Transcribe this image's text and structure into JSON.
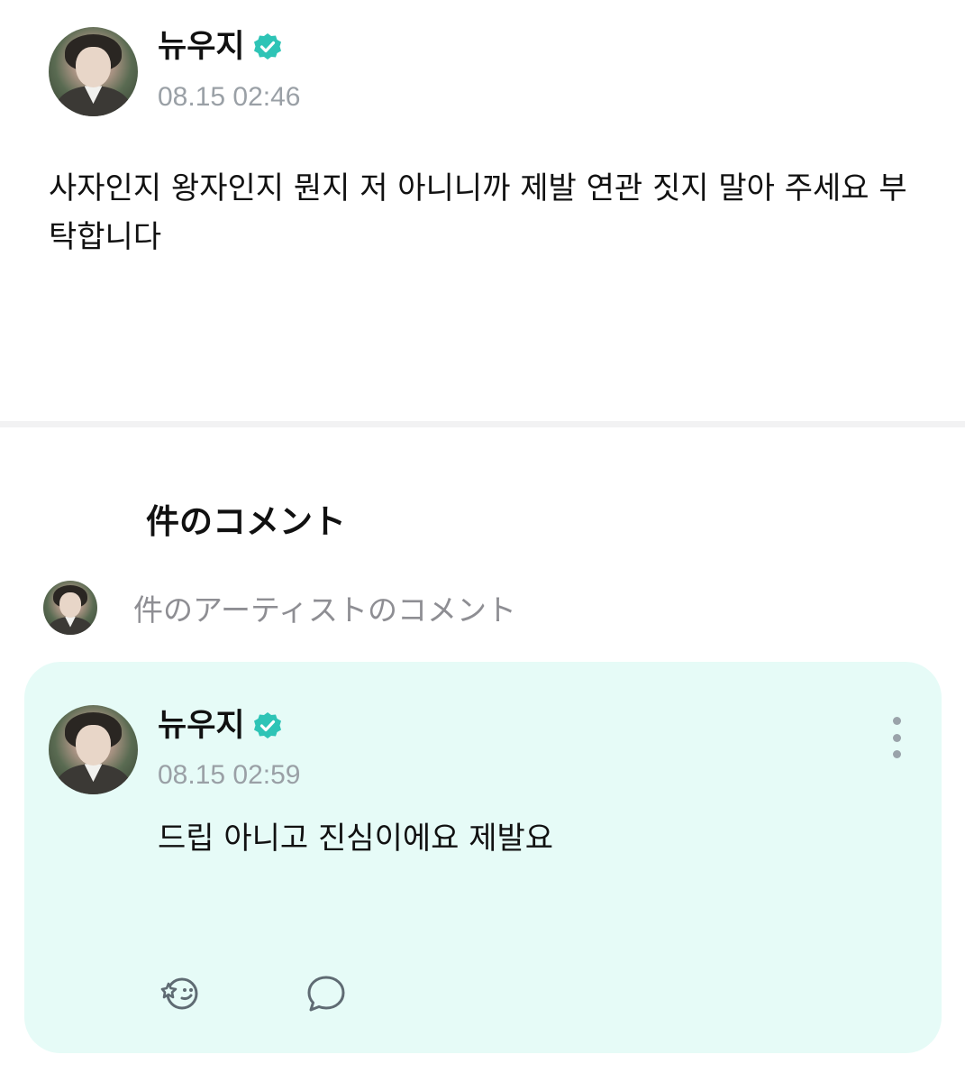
{
  "post": {
    "author": "뉴우지",
    "timestamp": "08.15 02:46",
    "body": "사자인지 왕자인지 뭔지 저 아니니까 제발 연관 짓지 말아 주세요 부탁합니다"
  },
  "comments_section": {
    "title": "件のコメント",
    "filter_label": "件のアーティストのコメント"
  },
  "comment": {
    "author": "뉴우지",
    "timestamp": "08.15 02:59",
    "body": "드립 아니고 진심이에요 제발요"
  },
  "icons": {
    "verified": "verified-badge-icon",
    "more": "more-vertical-icon",
    "react": "emoji-react-icon",
    "reply": "comment-bubble-icon"
  },
  "colors": {
    "verified": "#2ec4b6",
    "card_background": "#e6fbf7",
    "muted_text": "#9aa0a6"
  }
}
